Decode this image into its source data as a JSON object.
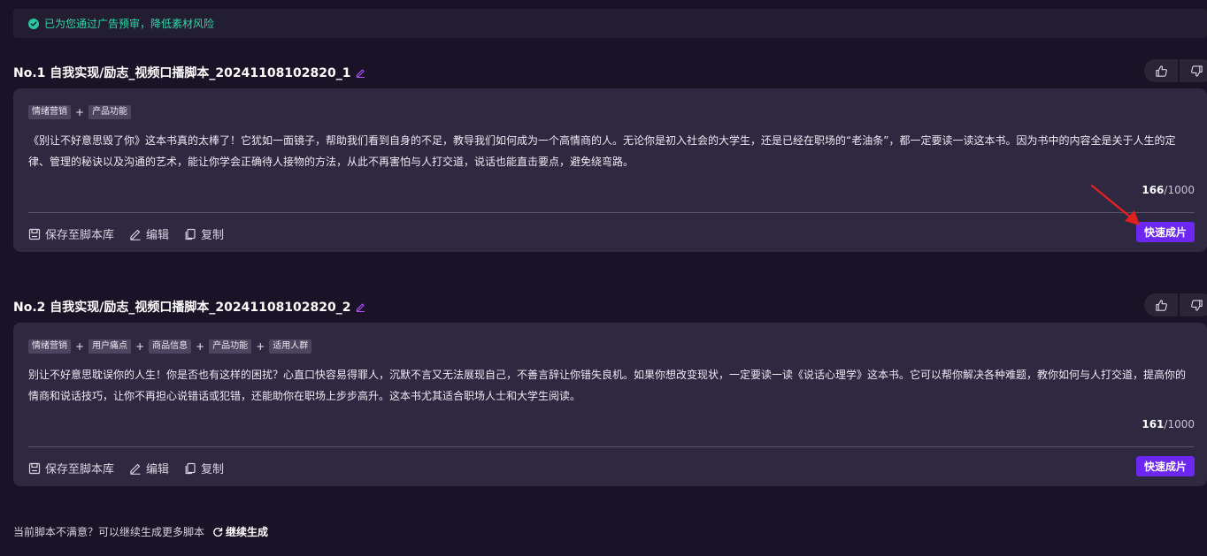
{
  "notice": {
    "text": "已为您通过广告预审，降低素材风险",
    "icon": "check-circle-icon",
    "color": "#2dd4ac"
  },
  "scripts": [
    {
      "title": "No.1 自我实现/励志_视频口播脚本_20241108102820_1",
      "tags": [
        "情绪营销",
        "产品功能"
      ],
      "text": "《别让不好意思毁了你》这本书真的太棒了！它犹如一面镜子，帮助我们看到自身的不足，教导我们如何成为一个高情商的人。无论你是初入社会的大学生，还是已经在职场的“老油条”，都一定要读一读这本书。因为书中的内容全是关于人生的定律、管理的秘诀以及沟通的艺术，能让你学会正确待人接物的方法，从此不再害怕与人打交道，说话也能直击要点，避免绕弯路。",
      "count": "166",
      "limit": "/1000",
      "actions": {
        "save": "保存至脚本库",
        "edit": "编辑",
        "copy": "复制"
      },
      "quick": "快速成片"
    },
    {
      "title": "No.2 自我实现/励志_视频口播脚本_20241108102820_2",
      "tags": [
        "情绪营销",
        "用户痛点",
        "商品信息",
        "产品功能",
        "适用人群"
      ],
      "text": "别让不好意思耽误你的人生！你是否也有这样的困扰？心直口快容易得罪人，沉默不言又无法展现自己，不善言辞让你错失良机。如果你想改变现状，一定要读一读《说话心理学》这本书。它可以帮你解决各种难题，教你如何与人打交道，提高你的情商和说话技巧，让你不再担心说错话或犯错，还能助你在职场上步步高升。这本书尤其适合职场人士和大学生阅读。",
      "count": "161",
      "limit": "/1000",
      "actions": {
        "save": "保存至脚本库",
        "edit": "编辑",
        "copy": "复制"
      },
      "quick": "快速成片"
    }
  ],
  "plus_sign": "+",
  "footer": {
    "prompt": "当前脚本不满意？可以继续生成更多脚本",
    "more": "继续生成"
  },
  "colors": {
    "accent": "#6d27f2",
    "pencil": "#b14cff",
    "arrow": "#e02020"
  }
}
